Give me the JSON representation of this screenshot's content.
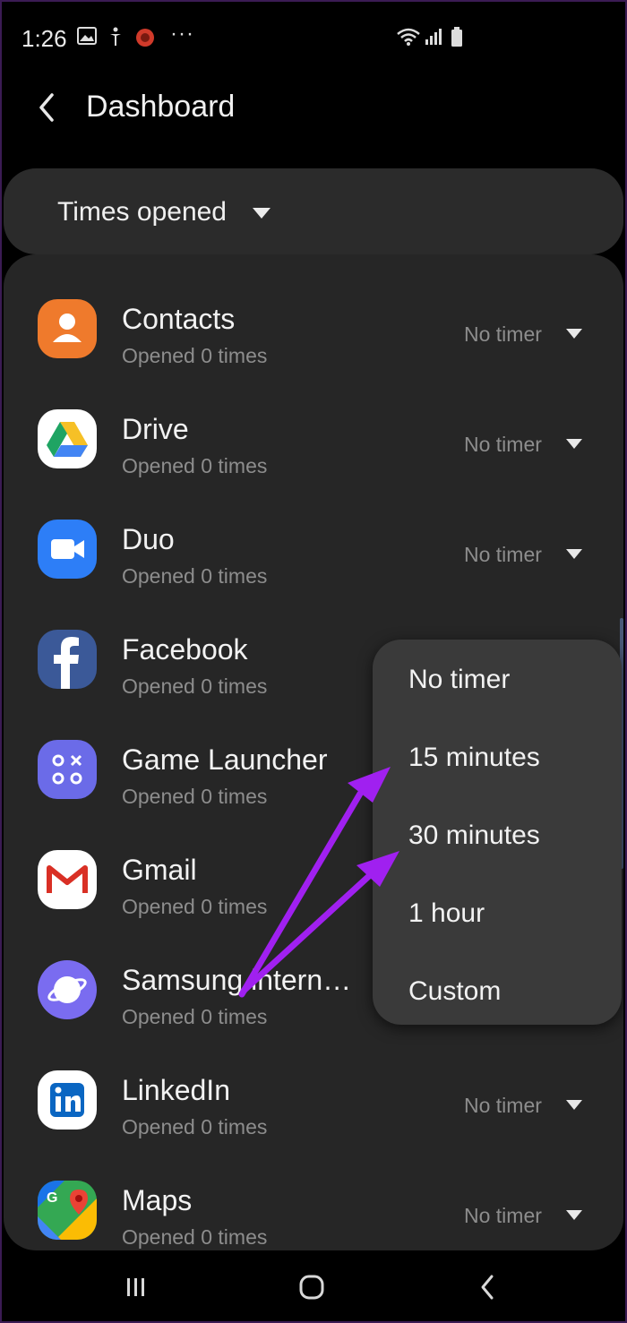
{
  "status_bar": {
    "time": "1:26",
    "more": "···"
  },
  "header": {
    "title": "Dashboard"
  },
  "sort": {
    "label": "Times opened"
  },
  "apps": [
    {
      "name": "Contacts",
      "sub": "Opened 0 times",
      "timer": "No timer",
      "icon": "contacts-icon",
      "color": "#ef7a2c"
    },
    {
      "name": "Drive",
      "sub": "Opened 0 times",
      "timer": "No timer",
      "icon": "drive-icon",
      "color": "#ffffff"
    },
    {
      "name": "Duo",
      "sub": "Opened 0 times",
      "timer": "No timer",
      "icon": "duo-icon",
      "color": "#2d7ef7"
    },
    {
      "name": "Facebook",
      "sub": "Opened 0 times",
      "timer": "",
      "icon": "facebook-icon",
      "color": "#3b5998"
    },
    {
      "name": "Game Launcher",
      "sub": "Opened 0 times",
      "timer": "",
      "icon": "game-launcher-icon",
      "color": "#6b6be8"
    },
    {
      "name": "Gmail",
      "sub": "Opened 0 times",
      "timer": "",
      "icon": "gmail-icon",
      "color": "#ffffff"
    },
    {
      "name": "Samsung intern…",
      "sub": "Opened 0 times",
      "timer": "",
      "icon": "samsung-internet-icon",
      "color": "#7a6cf0"
    },
    {
      "name": "LinkedIn",
      "sub": "Opened 0 times",
      "timer": "No timer",
      "icon": "linkedin-icon",
      "color": "#ffffff"
    },
    {
      "name": "Maps",
      "sub": "Opened 0 times",
      "timer": "No timer",
      "icon": "maps-icon",
      "color": "#34a853"
    }
  ],
  "timer_menu": {
    "options": [
      "No timer",
      "15 minutes",
      "30 minutes",
      "1 hour",
      "Custom"
    ]
  },
  "colors": {
    "background": "#000000",
    "card": "#262626",
    "popup": "#3a3a3a",
    "annotation_arrow": "#a020f0"
  }
}
